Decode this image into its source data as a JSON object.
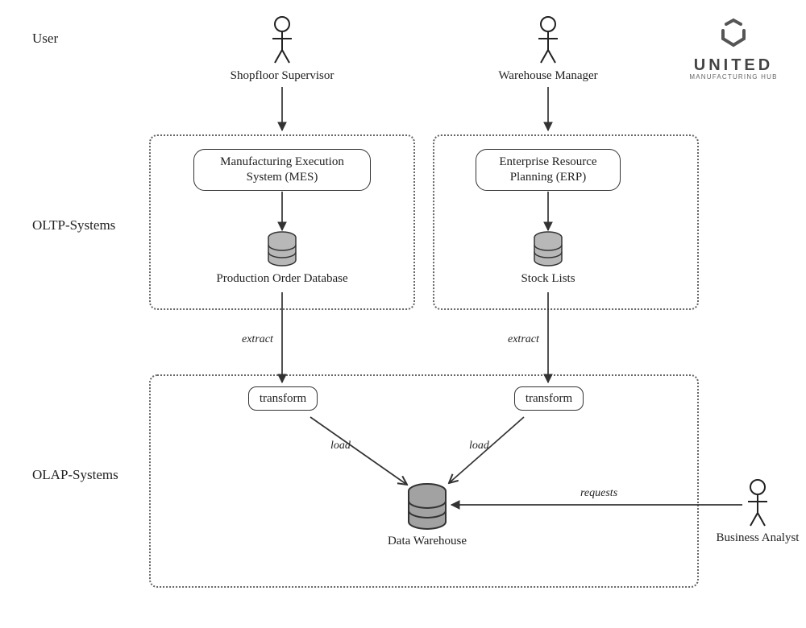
{
  "lanes": {
    "user": "User",
    "oltp": "OLTP-Systems",
    "olap": "OLAP-Systems"
  },
  "actors": {
    "shopfloor": "Shopfloor Supervisor",
    "warehouse": "Warehouse Manager",
    "analyst": "Business Analyst"
  },
  "nodes": {
    "mes": "Manufacturing Execution\nSystem (MES)",
    "erp": "Enterprise Resource\nPlanning (ERP)",
    "prod_db": "Production Order Database",
    "stock": "Stock Lists",
    "transform1": "transform",
    "transform2": "transform",
    "dwh": "Data Warehouse"
  },
  "edges": {
    "extract1": "extract",
    "extract2": "extract",
    "load1": "load",
    "load2": "load",
    "requests": "requests"
  },
  "logo": {
    "brand": "UNITED",
    "sub": "MANUFACTURING HUB"
  }
}
